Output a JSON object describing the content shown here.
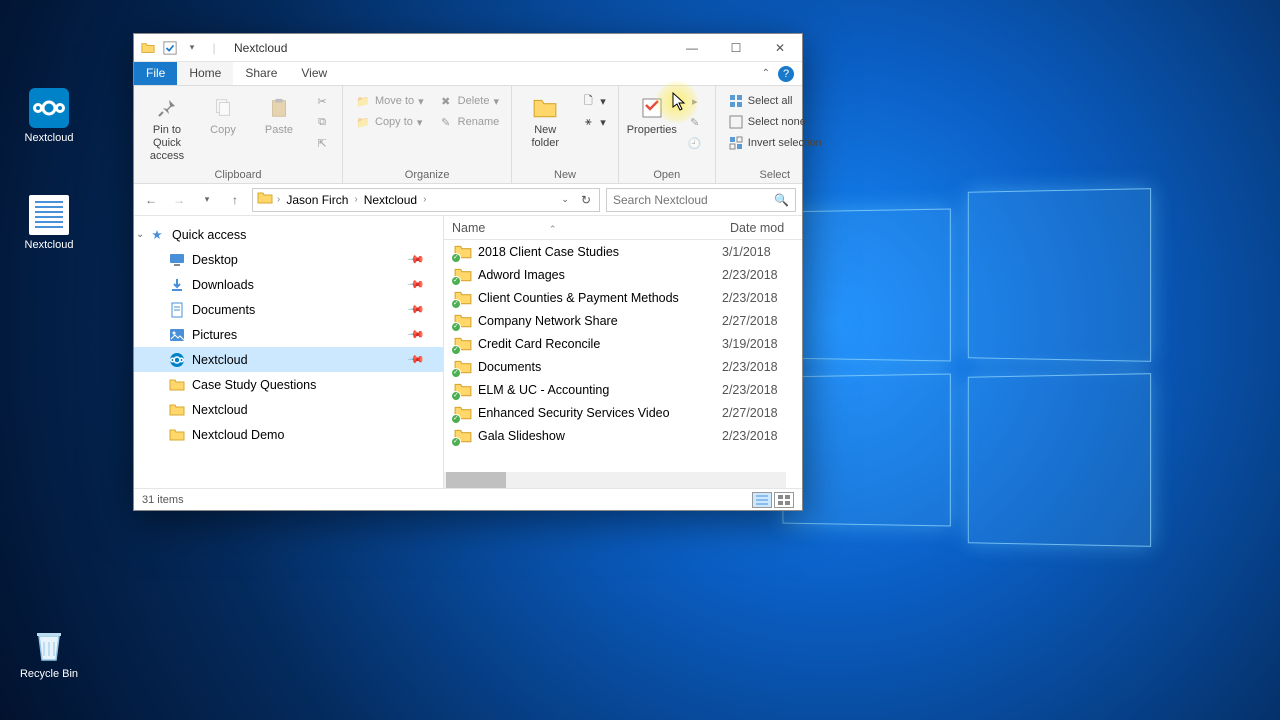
{
  "desktop": {
    "icons": [
      {
        "label": "Nextcloud",
        "type": "nc"
      },
      {
        "label": "Nextcloud",
        "type": "doc"
      },
      {
        "label": "Recycle Bin",
        "type": "bin"
      }
    ]
  },
  "window": {
    "title": "Nextcloud",
    "tabs": {
      "file": "File",
      "home": "Home",
      "share": "Share",
      "view": "View"
    },
    "controls": {
      "min": "—",
      "max": "☐",
      "close": "✕"
    }
  },
  "ribbon": {
    "clipboard": {
      "pin": "Pin to Quick access",
      "copy": "Copy",
      "paste": "Paste",
      "label": "Clipboard"
    },
    "organize": {
      "moveto": "Move to",
      "copyto": "Copy to",
      "delete": "Delete",
      "rename": "Rename",
      "label": "Organize"
    },
    "new": {
      "newfolder": "New folder",
      "label": "New"
    },
    "open": {
      "properties": "Properties",
      "label": "Open"
    },
    "select": {
      "selectall": "Select all",
      "selectnone": "Select none",
      "invert": "Invert selection",
      "label": "Select"
    }
  },
  "address": {
    "crumbs": [
      "Jason Firch",
      "Nextcloud"
    ],
    "search_placeholder": "Search Nextcloud"
  },
  "nav": {
    "quickaccess": "Quick access",
    "items": [
      {
        "label": "Desktop",
        "icon": "desktop",
        "pinned": true
      },
      {
        "label": "Downloads",
        "icon": "downloads",
        "pinned": true
      },
      {
        "label": "Documents",
        "icon": "documents",
        "pinned": true
      },
      {
        "label": "Pictures",
        "icon": "pictures",
        "pinned": true
      },
      {
        "label": "Nextcloud",
        "icon": "nextcloud",
        "pinned": true,
        "selected": true
      },
      {
        "label": "Case Study Questions",
        "icon": "folder"
      },
      {
        "label": "Nextcloud",
        "icon": "folder"
      },
      {
        "label": "Nextcloud Demo",
        "icon": "folder"
      }
    ]
  },
  "files": {
    "columns": {
      "name": "Name",
      "date": "Date mod"
    },
    "rows": [
      {
        "name": "2018 Client Case Studies",
        "date": "3/1/2018"
      },
      {
        "name": "Adword Images",
        "date": "2/23/2018"
      },
      {
        "name": "Client Counties & Payment Methods",
        "date": "2/23/2018"
      },
      {
        "name": "Company Network Share",
        "date": "2/27/2018"
      },
      {
        "name": "Credit Card Reconcile",
        "date": "3/19/2018"
      },
      {
        "name": "Documents",
        "date": "2/23/2018"
      },
      {
        "name": "ELM & UC - Accounting",
        "date": "2/23/2018"
      },
      {
        "name": "Enhanced Security Services Video",
        "date": "2/27/2018"
      },
      {
        "name": "Gala Slideshow",
        "date": "2/23/2018"
      }
    ]
  },
  "status": {
    "count": "31 items"
  }
}
